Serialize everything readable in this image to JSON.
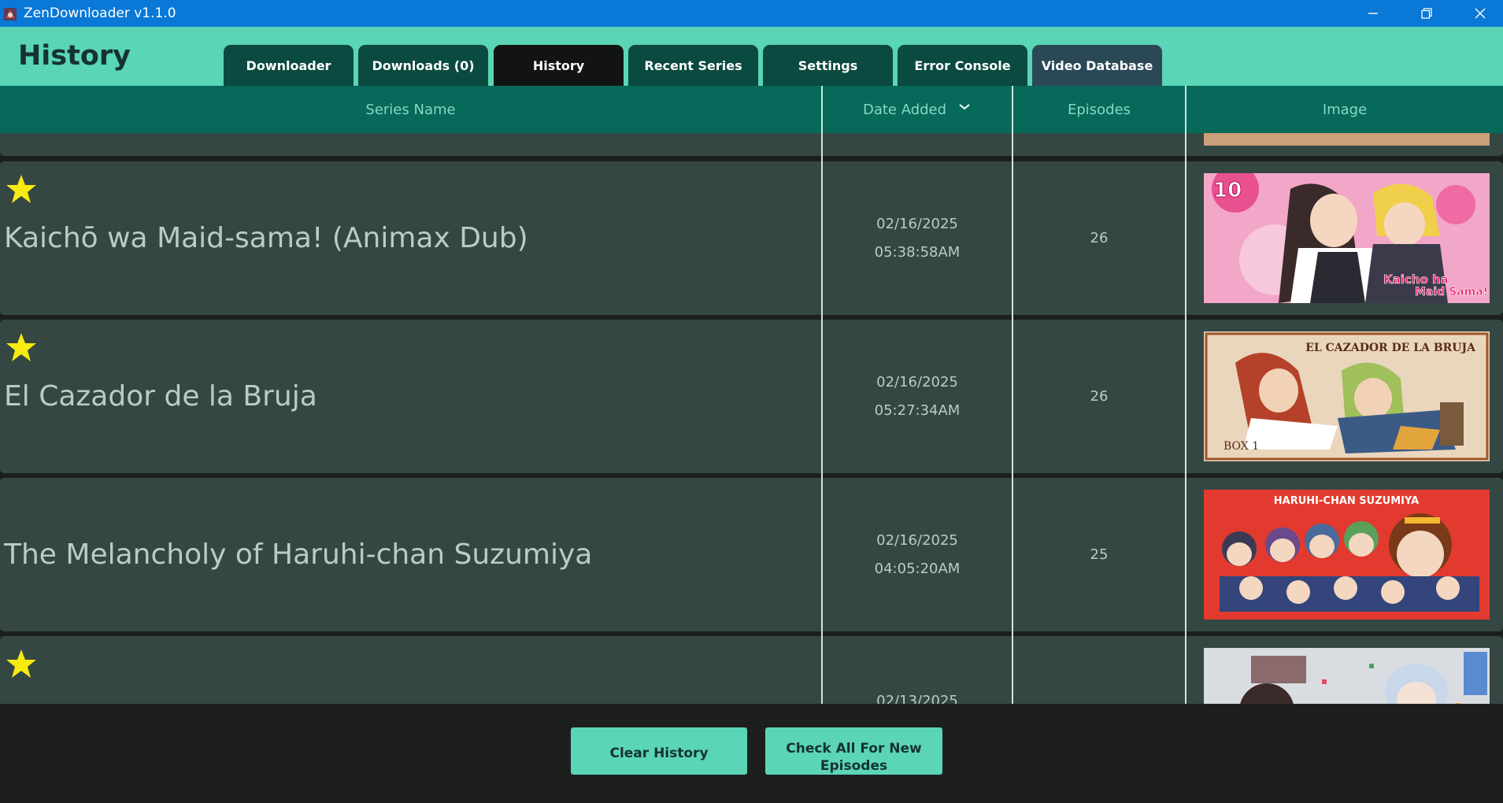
{
  "window": {
    "title": "ZenDownloader v1.1.0",
    "icon": "app-logo-icon",
    "controls": [
      "minimize-icon",
      "restore-icon",
      "close-icon"
    ]
  },
  "header": {
    "page_title": "History",
    "tabs": [
      {
        "label": "Downloader"
      },
      {
        "label": "Downloads (0)"
      },
      {
        "label": "History"
      },
      {
        "label": "Recent Series"
      },
      {
        "label": "Settings"
      },
      {
        "label": "Error Console"
      },
      {
        "label": "Video Database"
      }
    ],
    "active_tab": "History"
  },
  "table": {
    "columns": [
      "Series Name",
      "Date Added",
      "Episodes",
      "Image"
    ],
    "sort_indicator": "chevron-down-icon",
    "rows": [
      {
        "name": "",
        "favorite": false,
        "date": "",
        "time": "",
        "episodes": ""
      },
      {
        "name": "Kaichō wa Maid-sama! (Animax Dub)",
        "favorite": true,
        "date": "02/16/2025",
        "time": "05:38:58AM",
        "episodes": "26",
        "cover_text": "Kaicho ha Maid Sama!",
        "cover_number": "10"
      },
      {
        "name": "El Cazador de la Bruja",
        "favorite": true,
        "date": "02/16/2025",
        "time": "05:27:34AM",
        "episodes": "26",
        "cover_text": "EL CAZADOR DE LA BRUJA"
      },
      {
        "name": "The Melancholy of Haruhi-chan Suzumiya",
        "favorite": false,
        "date": "02/16/2025",
        "time": "04:05:20AM",
        "episodes": "25",
        "cover_text": "HARUHI-CHAN SUZUMIYA"
      },
      {
        "name": "",
        "favorite": true,
        "date": "02/13/2025",
        "time": "",
        "episodes": ""
      }
    ]
  },
  "footer": {
    "clear_history": "Clear History",
    "check_all_line1": "Check All For New",
    "check_all_line2": "Episodes"
  },
  "colors": {
    "accent": "#5ad5b5",
    "tab_bg": "#0b4a40",
    "tab_active": "#111413",
    "tab_database": "#2b4856",
    "table_header": "#06695a",
    "row_bg": "#344743",
    "star": "#f7ea10"
  }
}
